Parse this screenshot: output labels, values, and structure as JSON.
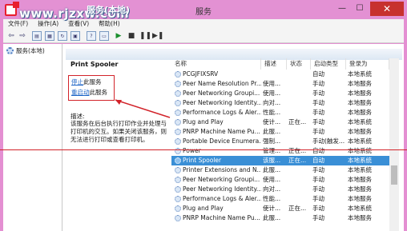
{
  "window": {
    "title": "服务"
  },
  "menu": [
    "文件(F)",
    "操作(A)",
    "查看(V)",
    "帮助(H)"
  ],
  "tree": {
    "root_label": "服务(本地)"
  },
  "watermark": {
    "text": "www.rjzxw.com",
    "header": "服务(本地)"
  },
  "detail": {
    "service_name": "Print Spooler",
    "stop_link": "停止",
    "stop_suffix": "此服务",
    "restart_link": "重启动",
    "restart_suffix": "此服务",
    "desc_label": "描述:",
    "desc_text": "该服务在后台执行打印作业并处理与打印机的交互。如果关闭该服务，则无法进行打印或查看打印机。"
  },
  "columns": {
    "name": "名称",
    "desc": "描述",
    "status": "状态",
    "startup": "启动类型",
    "logon": "登录为"
  },
  "rows": [
    {
      "name": "PCGJFIXSRV",
      "desc": "",
      "status": "",
      "startup": "自动",
      "logon": "本地系统"
    },
    {
      "name": "Peer Name Resolution Pr...",
      "desc": "使用...",
      "status": "",
      "startup": "手动",
      "logon": "本地服务"
    },
    {
      "name": "Peer Networking Groupi...",
      "desc": "使用...",
      "status": "",
      "startup": "手动",
      "logon": "本地服务"
    },
    {
      "name": "Peer Networking Identity...",
      "desc": "向对...",
      "status": "",
      "startup": "手动",
      "logon": "本地服务"
    },
    {
      "name": "Performance Logs & Aler...",
      "desc": "性能...",
      "status": "",
      "startup": "手动",
      "logon": "本地服务"
    },
    {
      "name": "Plug and Play",
      "desc": "使计...",
      "status": "正在...",
      "startup": "手动",
      "logon": "本地系统"
    },
    {
      "name": "PNRP Machine Name Pu...",
      "desc": "此服...",
      "status": "",
      "startup": "手动",
      "logon": "本地服务"
    },
    {
      "name": "Portable Device Enumera...",
      "desc": "强制...",
      "status": "",
      "startup": "手动(触发...",
      "logon": "本地系统"
    },
    {
      "name": "Power",
      "desc": "管理...",
      "status": "正在...",
      "startup": "自动",
      "logon": "本地系统"
    },
    {
      "name": "Print Spooler",
      "desc": "该服...",
      "status": "正在...",
      "startup": "自动",
      "logon": "本地系统",
      "selected": true
    },
    {
      "name": "Printer Extensions and N...",
      "desc": "此服...",
      "status": "",
      "startup": "手动",
      "logon": "本地系统"
    },
    {
      "name": "Peer Networking Groupi...",
      "desc": "使用...",
      "status": "",
      "startup": "手动",
      "logon": "本地服务"
    },
    {
      "name": "Peer Networking Identity...",
      "desc": "向对...",
      "status": "",
      "startup": "手动",
      "logon": "本地服务"
    },
    {
      "name": "Performance Logs & Aler...",
      "desc": "性能...",
      "status": "",
      "startup": "手动",
      "logon": "本地服务"
    },
    {
      "name": "Plug and Play",
      "desc": "使计...",
      "status": "正在...",
      "startup": "手动",
      "logon": "本地系统"
    },
    {
      "name": "PNRP Machine Name Pu...",
      "desc": "此服...",
      "status": "",
      "startup": "手动",
      "logon": "本地服务"
    }
  ],
  "colors": {
    "titlebar": "#e391d3",
    "close": "#c7312e",
    "selected_row": "#3a8fd6",
    "annotation": "#d2232a"
  },
  "icons": [
    "app-icon",
    "back-icon",
    "forward-icon",
    "play-icon",
    "stop-icon",
    "pause-icon",
    "restart-icon",
    "gear-icon"
  ]
}
